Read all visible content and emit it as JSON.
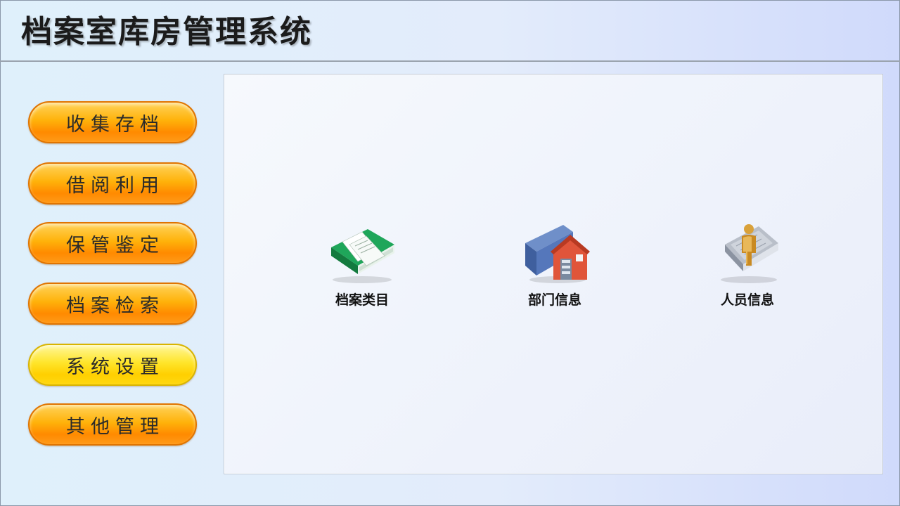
{
  "header": {
    "title": "档案室库房管理系统"
  },
  "sidebar": {
    "items": [
      {
        "label": "收集存档",
        "active": false
      },
      {
        "label": "借阅利用",
        "active": false
      },
      {
        "label": "保管鉴定",
        "active": false
      },
      {
        "label": "档案检索",
        "active": false
      },
      {
        "label": "系统设置",
        "active": true
      },
      {
        "label": "其他管理",
        "active": false
      }
    ]
  },
  "main": {
    "tiles": [
      {
        "label": "档案类目",
        "icon": "green-book-icon"
      },
      {
        "label": "部门信息",
        "icon": "folder-house-icon"
      },
      {
        "label": "人员信息",
        "icon": "person-document-icon"
      }
    ]
  },
  "colors": {
    "button_orange": "#ff9a00",
    "button_active_yellow": "#ffe52a",
    "panel": "#f1f4fc",
    "border": "#8a97a8"
  }
}
